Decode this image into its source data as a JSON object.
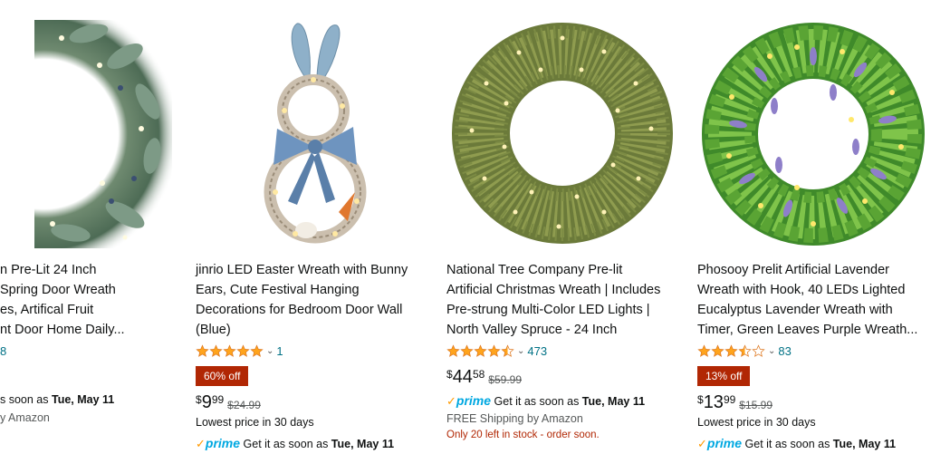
{
  "products": [
    {
      "title_lines": [
        "n Pre-Lit 24 Inch",
        "Spring Door Wreath",
        "es, Artifical Fruit",
        "nt Door Home Daily..."
      ],
      "rating_count": "8",
      "delivery_prefix": "s soon as ",
      "delivery_date": "Tue, May 11",
      "shipping": "y Amazon"
    },
    {
      "title_lines": [
        "jinrio LED Easter Wreath with Bunny",
        "Ears, Cute Festival Hanging",
        "Decorations for Bedroom Door Wall",
        "(Blue)"
      ],
      "rating": 5,
      "rating_count": "1",
      "badge": "60% off",
      "price_symbol": "$",
      "price_whole": "9",
      "price_fraction": "99",
      "was_price": "$24.99",
      "note": "Lowest price in 30 days",
      "prime_label": "prime",
      "delivery_prefix": "Get it as soon as ",
      "delivery_date": "Tue, May 11"
    },
    {
      "title_lines": [
        "National Tree Company Pre-lit",
        "Artificial Christmas Wreath | Includes",
        "Pre-strung Multi-Color LED Lights |",
        "North Valley Spruce - 24 Inch"
      ],
      "rating": 4.5,
      "rating_count": "473",
      "price_symbol": "$",
      "price_whole": "44",
      "price_fraction": "58",
      "was_price": "$59.99",
      "prime_label": "prime",
      "delivery_prefix": "Get it as soon as ",
      "delivery_date": "Tue, May 11",
      "shipping": "FREE Shipping by Amazon",
      "stock": "Only 20 left in stock - order soon."
    },
    {
      "title_lines": [
        "Phosooy Prelit Artificial Lavender",
        "Wreath with Hook, 40 LEDs Lighted",
        "Eucalyptus Lavender Wreath with",
        "Timer, Green Leaves Purple Wreath..."
      ],
      "rating": 3.5,
      "rating_count": "83",
      "badge": "13% off",
      "price_symbol": "$",
      "price_whole": "13",
      "price_fraction": "99",
      "was_price": "$15.99",
      "note": "Lowest price in 30 days",
      "prime_label": "prime",
      "delivery_prefix": "Get it as soon as ",
      "delivery_date": "Tue, May 11"
    }
  ],
  "colors": {
    "star": "#FFA41C",
    "badge": "#B12704",
    "link": "#007185",
    "prime": "#00A8E1"
  },
  "icons": [
    "product-image",
    "star-icon",
    "chevron-down-icon",
    "prime-check-icon"
  ]
}
